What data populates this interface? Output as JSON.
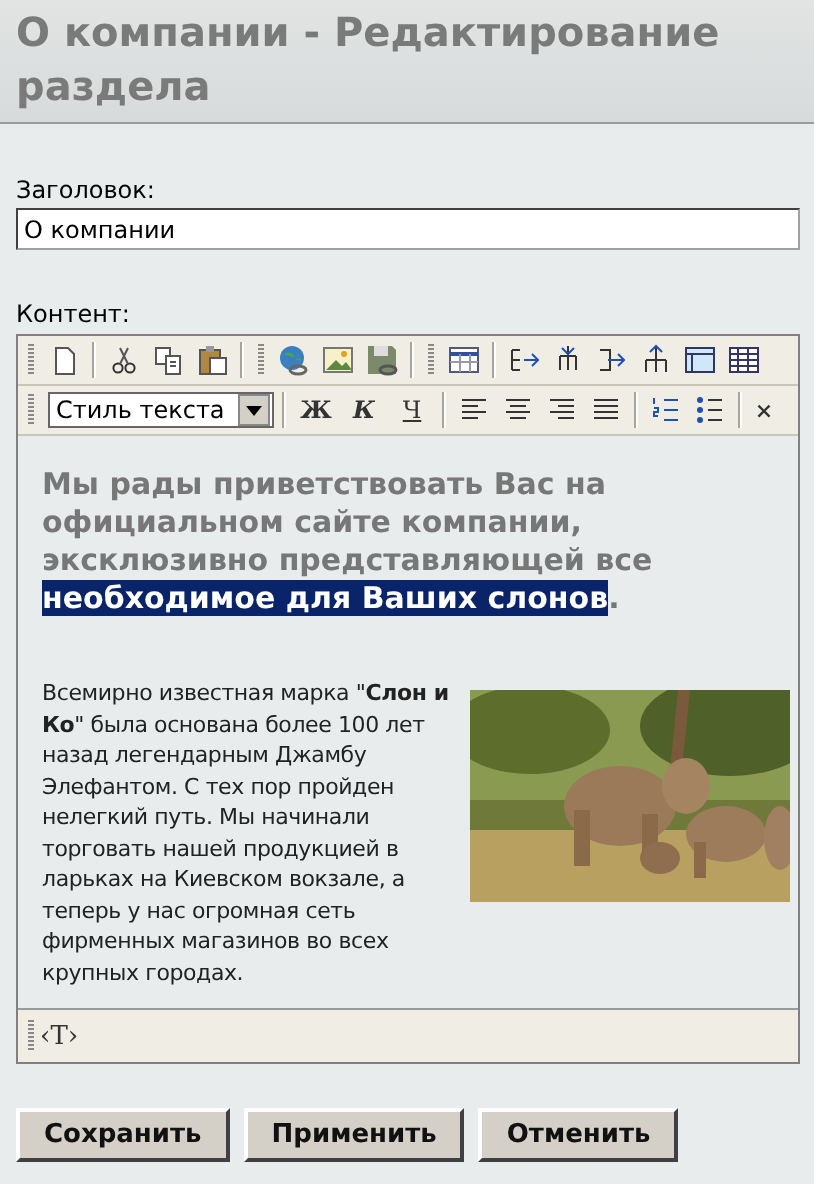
{
  "page": {
    "title": "О компании - Редактирование раздела"
  },
  "fields": [
    {
      "label": "Заголовок:",
      "value": "О компании"
    }
  ],
  "editor": {
    "label": "Контент:",
    "style_select": {
      "value": "Стиль текста"
    },
    "format_buttons": [
      {
        "kind": "bold",
        "label": "Ж"
      },
      {
        "kind": "italic",
        "label": "К"
      },
      {
        "kind": "underline",
        "label": "Ч"
      }
    ],
    "extra_button": "×",
    "content": [
      {
        "kind": "lead",
        "text": "Мы рады приветствовать Вас на официальном сайте компании, эксклюзивно представляющей все ",
        "selected_text": "необходимое для Ваших слонов",
        "after": "."
      },
      {
        "kind": "picture"
      },
      {
        "kind": "paragraph",
        "text": "Всемирно известная марка \"**Слон и Ко**\" была основана более 100 лет назад легендарным Джамбу Элефантом. С тех пор пройден нелегкий путь. Мы начинали торговать нашей продукцией в ларьках на Киевском вокзале, а теперь у нас огромная сеть фирменных магазинов во всех крупных городах."
      }
    ],
    "status_path": "‹T›"
  },
  "buttons": [
    "Сохранить",
    "Применить",
    "Отменить"
  ]
}
